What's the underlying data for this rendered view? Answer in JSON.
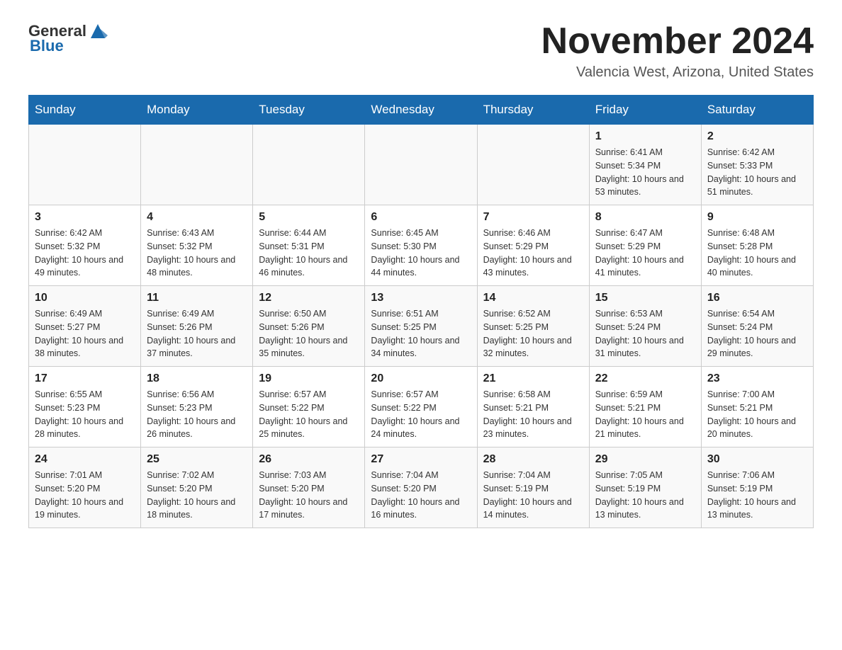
{
  "header": {
    "logo_general": "General",
    "logo_blue": "Blue",
    "month_title": "November 2024",
    "location": "Valencia West, Arizona, United States"
  },
  "days_of_week": [
    "Sunday",
    "Monday",
    "Tuesday",
    "Wednesday",
    "Thursday",
    "Friday",
    "Saturday"
  ],
  "weeks": [
    [
      {
        "day": "",
        "info": ""
      },
      {
        "day": "",
        "info": ""
      },
      {
        "day": "",
        "info": ""
      },
      {
        "day": "",
        "info": ""
      },
      {
        "day": "",
        "info": ""
      },
      {
        "day": "1",
        "info": "Sunrise: 6:41 AM\nSunset: 5:34 PM\nDaylight: 10 hours and 53 minutes."
      },
      {
        "day": "2",
        "info": "Sunrise: 6:42 AM\nSunset: 5:33 PM\nDaylight: 10 hours and 51 minutes."
      }
    ],
    [
      {
        "day": "3",
        "info": "Sunrise: 6:42 AM\nSunset: 5:32 PM\nDaylight: 10 hours and 49 minutes."
      },
      {
        "day": "4",
        "info": "Sunrise: 6:43 AM\nSunset: 5:32 PM\nDaylight: 10 hours and 48 minutes."
      },
      {
        "day": "5",
        "info": "Sunrise: 6:44 AM\nSunset: 5:31 PM\nDaylight: 10 hours and 46 minutes."
      },
      {
        "day": "6",
        "info": "Sunrise: 6:45 AM\nSunset: 5:30 PM\nDaylight: 10 hours and 44 minutes."
      },
      {
        "day": "7",
        "info": "Sunrise: 6:46 AM\nSunset: 5:29 PM\nDaylight: 10 hours and 43 minutes."
      },
      {
        "day": "8",
        "info": "Sunrise: 6:47 AM\nSunset: 5:29 PM\nDaylight: 10 hours and 41 minutes."
      },
      {
        "day": "9",
        "info": "Sunrise: 6:48 AM\nSunset: 5:28 PM\nDaylight: 10 hours and 40 minutes."
      }
    ],
    [
      {
        "day": "10",
        "info": "Sunrise: 6:49 AM\nSunset: 5:27 PM\nDaylight: 10 hours and 38 minutes."
      },
      {
        "day": "11",
        "info": "Sunrise: 6:49 AM\nSunset: 5:26 PM\nDaylight: 10 hours and 37 minutes."
      },
      {
        "day": "12",
        "info": "Sunrise: 6:50 AM\nSunset: 5:26 PM\nDaylight: 10 hours and 35 minutes."
      },
      {
        "day": "13",
        "info": "Sunrise: 6:51 AM\nSunset: 5:25 PM\nDaylight: 10 hours and 34 minutes."
      },
      {
        "day": "14",
        "info": "Sunrise: 6:52 AM\nSunset: 5:25 PM\nDaylight: 10 hours and 32 minutes."
      },
      {
        "day": "15",
        "info": "Sunrise: 6:53 AM\nSunset: 5:24 PM\nDaylight: 10 hours and 31 minutes."
      },
      {
        "day": "16",
        "info": "Sunrise: 6:54 AM\nSunset: 5:24 PM\nDaylight: 10 hours and 29 minutes."
      }
    ],
    [
      {
        "day": "17",
        "info": "Sunrise: 6:55 AM\nSunset: 5:23 PM\nDaylight: 10 hours and 28 minutes."
      },
      {
        "day": "18",
        "info": "Sunrise: 6:56 AM\nSunset: 5:23 PM\nDaylight: 10 hours and 26 minutes."
      },
      {
        "day": "19",
        "info": "Sunrise: 6:57 AM\nSunset: 5:22 PM\nDaylight: 10 hours and 25 minutes."
      },
      {
        "day": "20",
        "info": "Sunrise: 6:57 AM\nSunset: 5:22 PM\nDaylight: 10 hours and 24 minutes."
      },
      {
        "day": "21",
        "info": "Sunrise: 6:58 AM\nSunset: 5:21 PM\nDaylight: 10 hours and 23 minutes."
      },
      {
        "day": "22",
        "info": "Sunrise: 6:59 AM\nSunset: 5:21 PM\nDaylight: 10 hours and 21 minutes."
      },
      {
        "day": "23",
        "info": "Sunrise: 7:00 AM\nSunset: 5:21 PM\nDaylight: 10 hours and 20 minutes."
      }
    ],
    [
      {
        "day": "24",
        "info": "Sunrise: 7:01 AM\nSunset: 5:20 PM\nDaylight: 10 hours and 19 minutes."
      },
      {
        "day": "25",
        "info": "Sunrise: 7:02 AM\nSunset: 5:20 PM\nDaylight: 10 hours and 18 minutes."
      },
      {
        "day": "26",
        "info": "Sunrise: 7:03 AM\nSunset: 5:20 PM\nDaylight: 10 hours and 17 minutes."
      },
      {
        "day": "27",
        "info": "Sunrise: 7:04 AM\nSunset: 5:20 PM\nDaylight: 10 hours and 16 minutes."
      },
      {
        "day": "28",
        "info": "Sunrise: 7:04 AM\nSunset: 5:19 PM\nDaylight: 10 hours and 14 minutes."
      },
      {
        "day": "29",
        "info": "Sunrise: 7:05 AM\nSunset: 5:19 PM\nDaylight: 10 hours and 13 minutes."
      },
      {
        "day": "30",
        "info": "Sunrise: 7:06 AM\nSunset: 5:19 PM\nDaylight: 10 hours and 13 minutes."
      }
    ]
  ]
}
